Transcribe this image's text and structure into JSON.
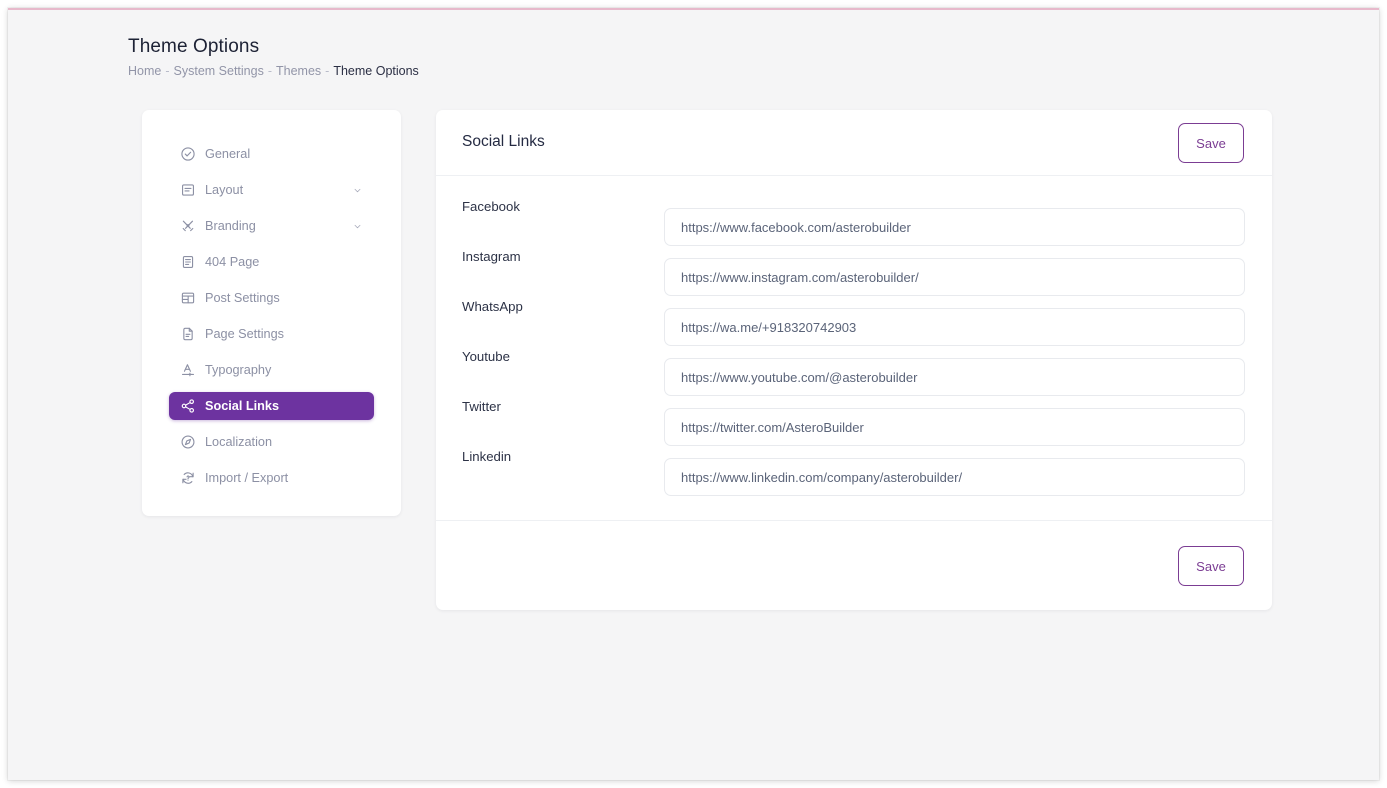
{
  "header": {
    "title": "Theme Options",
    "breadcrumb": [
      {
        "label": "Home",
        "active": false
      },
      {
        "label": "System Settings",
        "active": false
      },
      {
        "label": "Themes",
        "active": false
      },
      {
        "label": "Theme Options",
        "active": true
      }
    ],
    "separator": "-"
  },
  "sidebar": {
    "items": [
      {
        "label": "General",
        "icon": "check-circle-icon",
        "active": false,
        "expandable": false
      },
      {
        "label": "Layout",
        "icon": "layout-icon",
        "active": false,
        "expandable": true
      },
      {
        "label": "Branding",
        "icon": "branding-icon",
        "active": false,
        "expandable": true
      },
      {
        "label": "404 Page",
        "icon": "file-lines-icon",
        "active": false,
        "expandable": false
      },
      {
        "label": "Post Settings",
        "icon": "table-layout-icon",
        "active": false,
        "expandable": false
      },
      {
        "label": "Page Settings",
        "icon": "file-doc-icon",
        "active": false,
        "expandable": false
      },
      {
        "label": "Typography",
        "icon": "typography-icon",
        "active": false,
        "expandable": false
      },
      {
        "label": "Social Links",
        "icon": "share-nodes-icon",
        "active": true,
        "expandable": false
      },
      {
        "label": "Localization",
        "icon": "compass-icon",
        "active": false,
        "expandable": false
      },
      {
        "label": "Import / Export",
        "icon": "refresh-help-icon",
        "active": false,
        "expandable": false
      }
    ]
  },
  "main": {
    "title": "Social Links",
    "save_label_top": "Save",
    "save_label_bottom": "Save",
    "fields": [
      {
        "label": "Facebook",
        "value": "https://www.facebook.com/asterobuilder"
      },
      {
        "label": "Instagram",
        "value": "https://www.instagram.com/asterobuilder/"
      },
      {
        "label": "WhatsApp",
        "value": "https://wa.me/+918320742903"
      },
      {
        "label": "Youtube",
        "value": "https://www.youtube.com/@asterobuilder"
      },
      {
        "label": "Twitter",
        "value": "https://twitter.com/AsteroBuilder"
      },
      {
        "label": "Linkedin",
        "value": "https://www.linkedin.com/company/asterobuilder/"
      }
    ]
  },
  "colors": {
    "accent": "#6d33a0",
    "save_border": "#7b3d93",
    "page_bg": "#f5f5f6",
    "top_rule": "#e7b9cb"
  }
}
